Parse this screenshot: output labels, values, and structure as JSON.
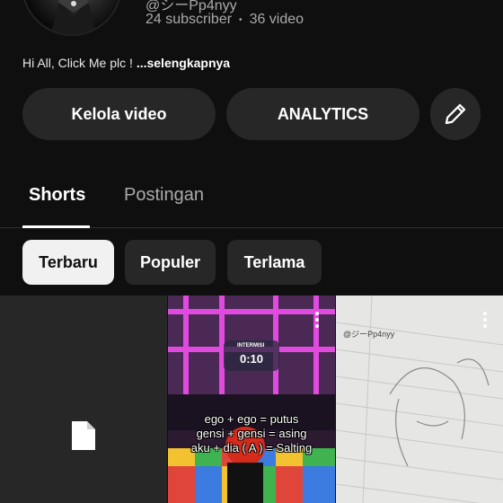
{
  "channel": {
    "handle": "@シーPp4nyy",
    "subscribers": "24 subscriber",
    "separator": "•",
    "videos": "36 video",
    "description": "Hi All, Click Me plc ! ",
    "more_label": "...selengkapnya"
  },
  "actions": {
    "manage_label": "Kelola video",
    "analytics_label": "ANALYTICS",
    "edit_icon": "pencil-icon"
  },
  "tabs": [
    {
      "label": "Shorts",
      "selected": true
    },
    {
      "label": "Postingan",
      "selected": false
    }
  ],
  "filters": [
    {
      "label": "Terbaru",
      "selected": true
    },
    {
      "label": "Populer",
      "selected": false
    },
    {
      "label": "Terlama",
      "selected": false
    }
  ],
  "shorts": [
    {
      "icon": "file-icon"
    },
    {
      "overlay_label": "INTERMISI",
      "timer": "0:10",
      "lines": [
        "ego + ego = putus",
        "gensi + gensi = asing",
        "aku + dia ( A ) = Salting"
      ]
    },
    {
      "watermark": "@ジーPp4nyy"
    }
  ],
  "colors": {
    "background": "#0f0f0f",
    "button": "#272727",
    "chip_selected": "#f1f1f1",
    "text_secondary": "#aaaaaa"
  }
}
